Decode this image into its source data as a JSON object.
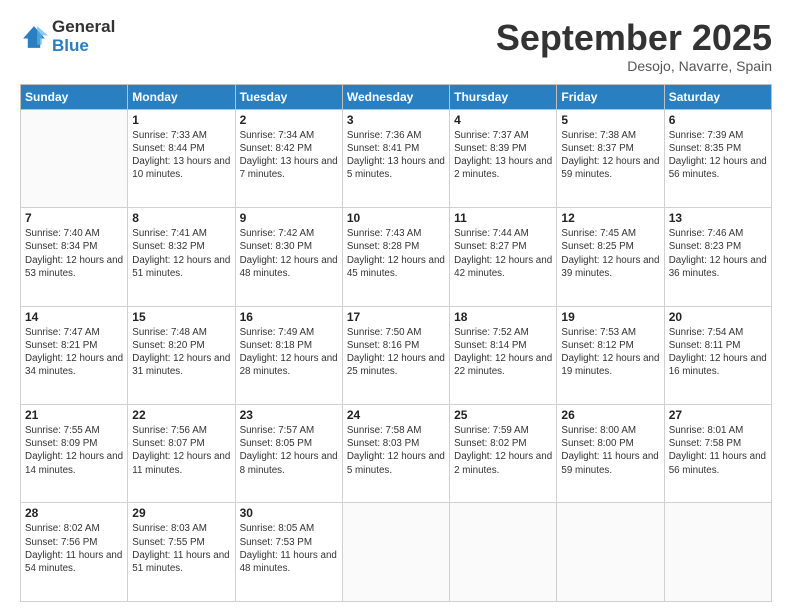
{
  "logo": {
    "general": "General",
    "blue": "Blue"
  },
  "header": {
    "month": "September 2025",
    "location": "Desojo, Navarre, Spain"
  },
  "days_of_week": [
    "Sunday",
    "Monday",
    "Tuesday",
    "Wednesday",
    "Thursday",
    "Friday",
    "Saturday"
  ],
  "weeks": [
    [
      {
        "day": null,
        "sunrise": null,
        "sunset": null,
        "daylight": null
      },
      {
        "day": "1",
        "sunrise": "Sunrise: 7:33 AM",
        "sunset": "Sunset: 8:44 PM",
        "daylight": "Daylight: 13 hours and 10 minutes."
      },
      {
        "day": "2",
        "sunrise": "Sunrise: 7:34 AM",
        "sunset": "Sunset: 8:42 PM",
        "daylight": "Daylight: 13 hours and 7 minutes."
      },
      {
        "day": "3",
        "sunrise": "Sunrise: 7:36 AM",
        "sunset": "Sunset: 8:41 PM",
        "daylight": "Daylight: 13 hours and 5 minutes."
      },
      {
        "day": "4",
        "sunrise": "Sunrise: 7:37 AM",
        "sunset": "Sunset: 8:39 PM",
        "daylight": "Daylight: 13 hours and 2 minutes."
      },
      {
        "day": "5",
        "sunrise": "Sunrise: 7:38 AM",
        "sunset": "Sunset: 8:37 PM",
        "daylight": "Daylight: 12 hours and 59 minutes."
      },
      {
        "day": "6",
        "sunrise": "Sunrise: 7:39 AM",
        "sunset": "Sunset: 8:35 PM",
        "daylight": "Daylight: 12 hours and 56 minutes."
      }
    ],
    [
      {
        "day": "7",
        "sunrise": "Sunrise: 7:40 AM",
        "sunset": "Sunset: 8:34 PM",
        "daylight": "Daylight: 12 hours and 53 minutes."
      },
      {
        "day": "8",
        "sunrise": "Sunrise: 7:41 AM",
        "sunset": "Sunset: 8:32 PM",
        "daylight": "Daylight: 12 hours and 51 minutes."
      },
      {
        "day": "9",
        "sunrise": "Sunrise: 7:42 AM",
        "sunset": "Sunset: 8:30 PM",
        "daylight": "Daylight: 12 hours and 48 minutes."
      },
      {
        "day": "10",
        "sunrise": "Sunrise: 7:43 AM",
        "sunset": "Sunset: 8:28 PM",
        "daylight": "Daylight: 12 hours and 45 minutes."
      },
      {
        "day": "11",
        "sunrise": "Sunrise: 7:44 AM",
        "sunset": "Sunset: 8:27 PM",
        "daylight": "Daylight: 12 hours and 42 minutes."
      },
      {
        "day": "12",
        "sunrise": "Sunrise: 7:45 AM",
        "sunset": "Sunset: 8:25 PM",
        "daylight": "Daylight: 12 hours and 39 minutes."
      },
      {
        "day": "13",
        "sunrise": "Sunrise: 7:46 AM",
        "sunset": "Sunset: 8:23 PM",
        "daylight": "Daylight: 12 hours and 36 minutes."
      }
    ],
    [
      {
        "day": "14",
        "sunrise": "Sunrise: 7:47 AM",
        "sunset": "Sunset: 8:21 PM",
        "daylight": "Daylight: 12 hours and 34 minutes."
      },
      {
        "day": "15",
        "sunrise": "Sunrise: 7:48 AM",
        "sunset": "Sunset: 8:20 PM",
        "daylight": "Daylight: 12 hours and 31 minutes."
      },
      {
        "day": "16",
        "sunrise": "Sunrise: 7:49 AM",
        "sunset": "Sunset: 8:18 PM",
        "daylight": "Daylight: 12 hours and 28 minutes."
      },
      {
        "day": "17",
        "sunrise": "Sunrise: 7:50 AM",
        "sunset": "Sunset: 8:16 PM",
        "daylight": "Daylight: 12 hours and 25 minutes."
      },
      {
        "day": "18",
        "sunrise": "Sunrise: 7:52 AM",
        "sunset": "Sunset: 8:14 PM",
        "daylight": "Daylight: 12 hours and 22 minutes."
      },
      {
        "day": "19",
        "sunrise": "Sunrise: 7:53 AM",
        "sunset": "Sunset: 8:12 PM",
        "daylight": "Daylight: 12 hours and 19 minutes."
      },
      {
        "day": "20",
        "sunrise": "Sunrise: 7:54 AM",
        "sunset": "Sunset: 8:11 PM",
        "daylight": "Daylight: 12 hours and 16 minutes."
      }
    ],
    [
      {
        "day": "21",
        "sunrise": "Sunrise: 7:55 AM",
        "sunset": "Sunset: 8:09 PM",
        "daylight": "Daylight: 12 hours and 14 minutes."
      },
      {
        "day": "22",
        "sunrise": "Sunrise: 7:56 AM",
        "sunset": "Sunset: 8:07 PM",
        "daylight": "Daylight: 12 hours and 11 minutes."
      },
      {
        "day": "23",
        "sunrise": "Sunrise: 7:57 AM",
        "sunset": "Sunset: 8:05 PM",
        "daylight": "Daylight: 12 hours and 8 minutes."
      },
      {
        "day": "24",
        "sunrise": "Sunrise: 7:58 AM",
        "sunset": "Sunset: 8:03 PM",
        "daylight": "Daylight: 12 hours and 5 minutes."
      },
      {
        "day": "25",
        "sunrise": "Sunrise: 7:59 AM",
        "sunset": "Sunset: 8:02 PM",
        "daylight": "Daylight: 12 hours and 2 minutes."
      },
      {
        "day": "26",
        "sunrise": "Sunrise: 8:00 AM",
        "sunset": "Sunset: 8:00 PM",
        "daylight": "Daylight: 11 hours and 59 minutes."
      },
      {
        "day": "27",
        "sunrise": "Sunrise: 8:01 AM",
        "sunset": "Sunset: 7:58 PM",
        "daylight": "Daylight: 11 hours and 56 minutes."
      }
    ],
    [
      {
        "day": "28",
        "sunrise": "Sunrise: 8:02 AM",
        "sunset": "Sunset: 7:56 PM",
        "daylight": "Daylight: 11 hours and 54 minutes."
      },
      {
        "day": "29",
        "sunrise": "Sunrise: 8:03 AM",
        "sunset": "Sunset: 7:55 PM",
        "daylight": "Daylight: 11 hours and 51 minutes."
      },
      {
        "day": "30",
        "sunrise": "Sunrise: 8:05 AM",
        "sunset": "Sunset: 7:53 PM",
        "daylight": "Daylight: 11 hours and 48 minutes."
      },
      {
        "day": null,
        "sunrise": null,
        "sunset": null,
        "daylight": null
      },
      {
        "day": null,
        "sunrise": null,
        "sunset": null,
        "daylight": null
      },
      {
        "day": null,
        "sunrise": null,
        "sunset": null,
        "daylight": null
      },
      {
        "day": null,
        "sunrise": null,
        "sunset": null,
        "daylight": null
      }
    ]
  ]
}
